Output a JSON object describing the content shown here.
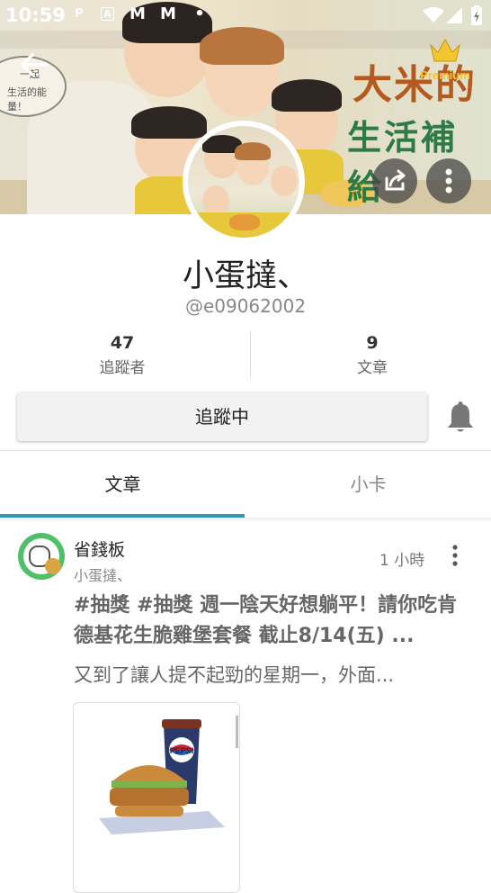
{
  "status_bar": {
    "time": "10:59",
    "notif_icons": [
      "P",
      "A",
      "M",
      "M",
      "•"
    ]
  },
  "banner": {
    "sign_line1": "大米的",
    "sign_line2": "生活補給",
    "bubble_line1": "一起",
    "bubble_line2": "生活的能量！",
    "premium_label": "Premium"
  },
  "profile": {
    "name": "小蛋撻、",
    "handle": "@e09062002",
    "stats": [
      {
        "value": "47",
        "label": "追蹤者"
      },
      {
        "value": "9",
        "label": "文章"
      }
    ],
    "follow_button": "追蹤中"
  },
  "tabs": [
    {
      "label": "文章",
      "active": true
    },
    {
      "label": "小卡",
      "active": false
    }
  ],
  "post": {
    "board": "省錢板",
    "author": "小蛋撻、",
    "time": "1 小時",
    "title": "#抽獎 #抽獎 週一陰天好想躺平！請你吃肯德基花生脆雞堡套餐 截止8/14(五) ...",
    "excerpt": "又到了讓人提不起勁的星期一，外面...",
    "thumbnail_label": "PEPSI"
  },
  "colors": {
    "accent": "#3397b5",
    "premium_gold": "#f3c530",
    "board_avatar": "#4fbf68"
  }
}
